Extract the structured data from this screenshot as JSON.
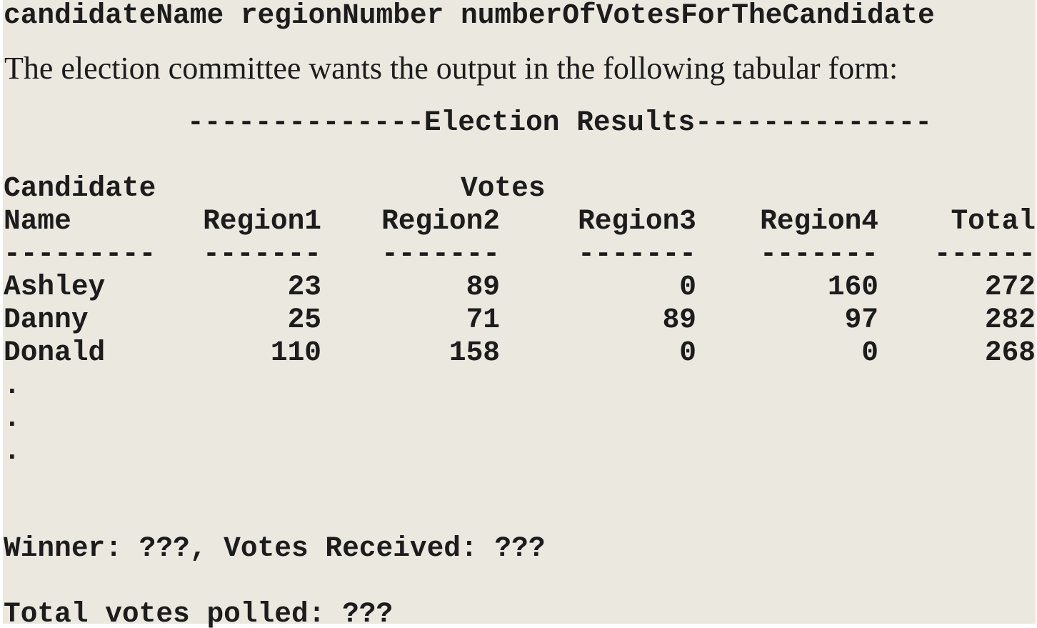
{
  "input_format_line": "candidateName regionNumber numberOfVotesForTheCandidate",
  "intro_sentence": "The election committee wants the output in the following tabular form:",
  "report": {
    "title_line": "--------------Election Results--------------",
    "header_candidate": "Candidate",
    "header_votes": "Votes",
    "header_name": "Name",
    "columns": [
      "Region1",
      "Region2",
      "Region3",
      "Region4",
      "Total"
    ],
    "underline_name": "---------",
    "underline_columns": [
      "-------",
      "-------",
      "-------",
      "-------",
      "------"
    ],
    "rows": [
      {
        "name": "Ashley",
        "values": [
          "23",
          "89",
          "0",
          "160",
          "272"
        ]
      },
      {
        "name": "Danny",
        "values": [
          "25",
          "71",
          "89",
          "97",
          "282"
        ]
      },
      {
        "name": "Donald",
        "values": [
          "110",
          "158",
          "0",
          "0",
          "268"
        ]
      }
    ],
    "ellipsis": [
      ".",
      ".",
      "."
    ],
    "winner_line": "Winner: ???, Votes Received: ???",
    "total_line": "Total votes polled: ???"
  }
}
